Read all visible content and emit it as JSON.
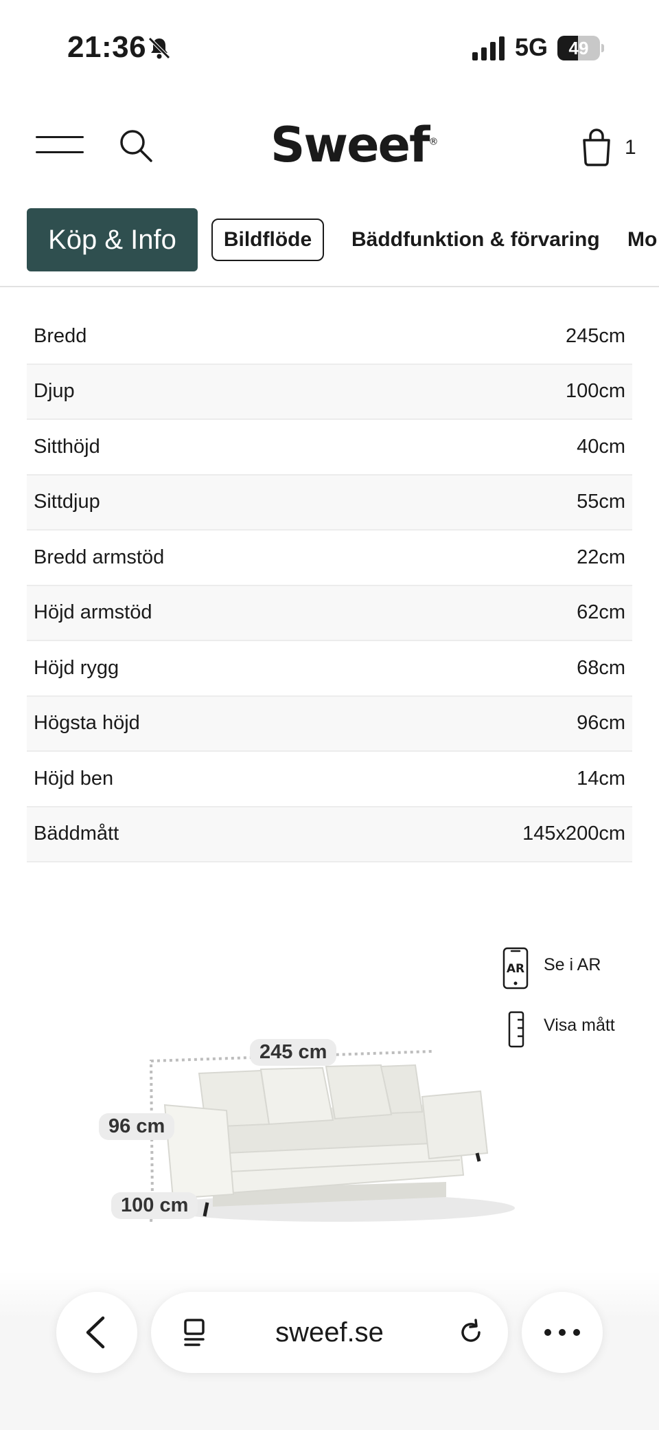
{
  "status_bar": {
    "time": "21:36",
    "network": "5G",
    "battery": "49",
    "battery_level": 0.49
  },
  "header": {
    "logo": "Sweef",
    "logo_mark": "®",
    "cart_count": "1",
    "icons": [
      "menu-icon",
      "search-icon",
      "shopping-bag-icon"
    ]
  },
  "tabs": [
    {
      "label": "Köp & Info",
      "state": "active"
    },
    {
      "label": "Bildflöde",
      "state": "outlined"
    },
    {
      "label": "Bäddfunktion & förvaring",
      "state": "plain"
    },
    {
      "label": "Mo",
      "state": "plain"
    }
  ],
  "specs": [
    {
      "label": "Bredd",
      "value": "245cm"
    },
    {
      "label": "Djup",
      "value": "100cm"
    },
    {
      "label": "Sitthöjd",
      "value": "40cm"
    },
    {
      "label": "Sittdjup",
      "value": "55cm"
    },
    {
      "label": "Bredd armstöd",
      "value": "22cm"
    },
    {
      "label": "Höjd armstöd",
      "value": "62cm"
    },
    {
      "label": "Höjd rygg",
      "value": "68cm"
    },
    {
      "label": "Högsta höjd",
      "value": "96cm"
    },
    {
      "label": "Höjd ben",
      "value": "14cm"
    },
    {
      "label": "Bäddmått",
      "value": "145x200cm"
    }
  ],
  "viewer": {
    "ar_label": "Se i AR",
    "ar_icon_text": "AR",
    "dimensions_label": "Visa mått",
    "badges": {
      "width": "245 cm",
      "height": "96 cm",
      "depth": "100 cm"
    }
  },
  "browser": {
    "url": "sweef.se",
    "icons": [
      "chevron-left-icon",
      "tabs-icon",
      "reload-icon",
      "more-icon"
    ]
  },
  "colors": {
    "accent": "#2f4f4f",
    "text": "#1a1a1a"
  }
}
